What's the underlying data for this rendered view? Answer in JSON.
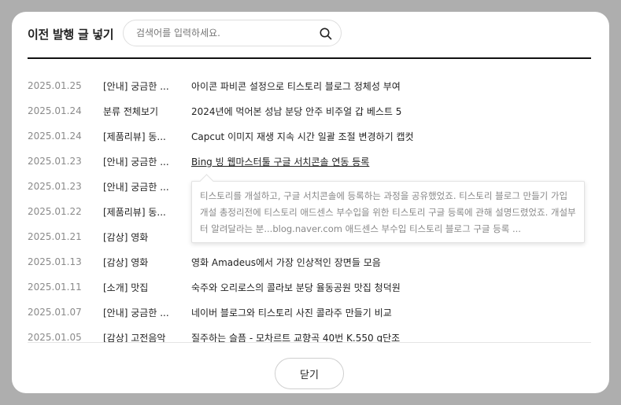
{
  "dialog": {
    "title": "이전 발행 글 넣기",
    "search": {
      "placeholder": "검색어를 입력하세요.",
      "value": ""
    },
    "close_label": "닫기"
  },
  "posts": [
    {
      "date": "2025.01.25",
      "category": "[안내] 궁금한 ...",
      "title": "아이콘 파비콘 설정으로 티스토리 블로그 정체성 부여"
    },
    {
      "date": "2025.01.24",
      "category": "분류 전체보기",
      "title": "2024년에 먹어본 성남 분당 안주 비주얼 갑 베스트 5"
    },
    {
      "date": "2025.01.24",
      "category": "[제품리뷰] 동...",
      "title": "Capcut 이미지 재생 지속 시간 일괄 조절 변경하기 캡컷"
    },
    {
      "date": "2025.01.23",
      "category": "[안내] 궁금한 ...",
      "title": "Bing 빙 웹마스터툴 구글 서치콘솔 연동 등록"
    },
    {
      "date": "2025.01.23",
      "category": "[안내] 궁금한 ...",
      "title": ""
    },
    {
      "date": "2025.01.22",
      "category": "[제품리뷰] 동...",
      "title": ""
    },
    {
      "date": "2025.01.21",
      "category": "[감상] 영화",
      "title": ""
    },
    {
      "date": "2025.01.13",
      "category": "[감상] 영화",
      "title": "영화 Amadeus에서 가장 인상적인 장면들 모음"
    },
    {
      "date": "2025.01.11",
      "category": "[소개] 맛집",
      "title": "숙주와 오리로스의 콜라보 분당 율동공원 맛집 청덕원"
    },
    {
      "date": "2025.01.07",
      "category": "[안내] 궁금한 ...",
      "title": "네이버 블로그와 티스토리 사진 콜라주 만들기 비교"
    },
    {
      "date": "2025.01.05",
      "category": "[감상] 고전음악",
      "title": "질주하는 슬픔 - 모차르트 교향곡 40번 K.550 g단조"
    }
  ],
  "tooltip": {
    "text": "티스토리를 개설하고, 구글 서치콘솔에 등록하는 과정을 공유했었죠.   티스토리 블로그 만들기 가입 개설 총정리전에 티스토리 애드센스 부수입을 위한 티스토리 구글 등록에 관해 설명드렸었죠. 개설부터 알려달라는 분...blog.naver.com  애드센스 부수입 티스토리 블로그 구글 등록 ..."
  }
}
